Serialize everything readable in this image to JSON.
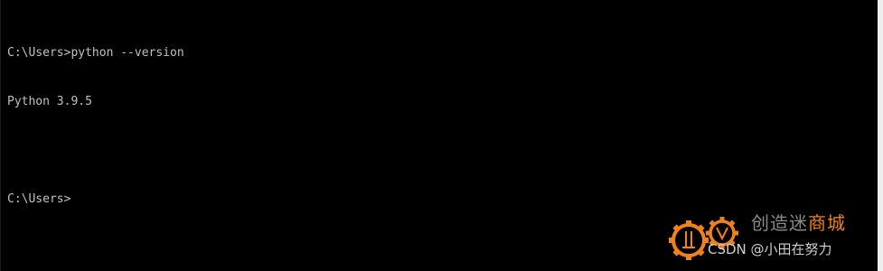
{
  "terminal": {
    "lines": [
      "C:\\Users>python --version",
      "Python 3.9.5",
      "",
      "C:\\Users>"
    ]
  },
  "watermark": {
    "title_plain": "创造迷",
    "title_accent": "商城",
    "subtitle": "CSDN @小田在努力",
    "accent_color": "#f0821e"
  }
}
